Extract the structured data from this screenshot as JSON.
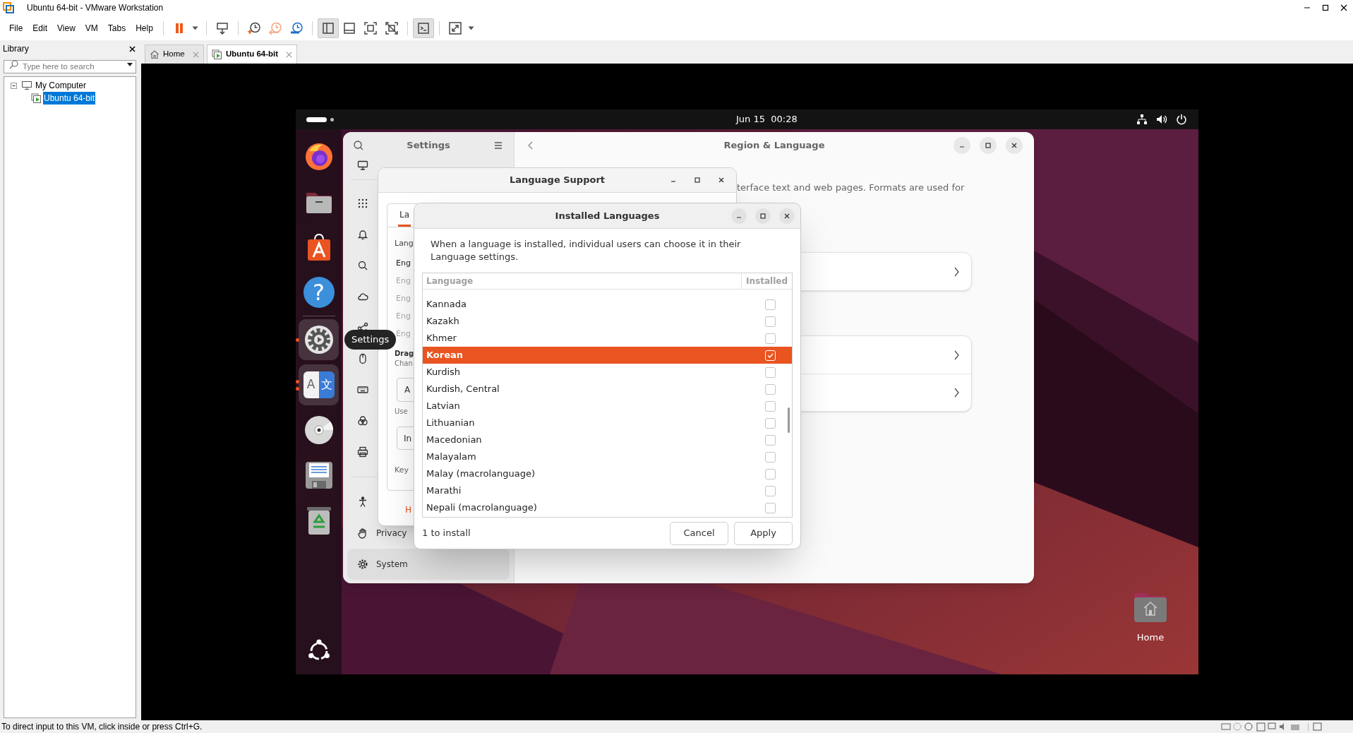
{
  "window": {
    "title": "Ubuntu 64-bit - VMware Workstation"
  },
  "menu": [
    {
      "label": "File"
    },
    {
      "label": "Edit"
    },
    {
      "label": "View"
    },
    {
      "label": "VM"
    },
    {
      "label": "Tabs"
    },
    {
      "label": "Help"
    }
  ],
  "toolbar_groups": [
    {
      "items": [
        {
          "kind": "pause",
          "selected": false
        },
        {
          "kind": "caret",
          "selected": false
        }
      ]
    },
    {
      "items": [
        {
          "kind": "send_keys",
          "selected": false
        }
      ]
    },
    {
      "items": [
        {
          "kind": "snapshot",
          "selected": false
        },
        {
          "kind": "revert",
          "selected": false
        },
        {
          "kind": "snapshot_manager",
          "selected": false
        }
      ]
    },
    {
      "items": [
        {
          "kind": "library_view",
          "selected": true
        },
        {
          "kind": "thumbnail_bar",
          "selected": false
        },
        {
          "kind": "full_screen",
          "selected": false
        },
        {
          "kind": "unity",
          "selected": false
        }
      ]
    },
    {
      "items": [
        {
          "kind": "console_view",
          "selected": true
        }
      ]
    },
    {
      "items": [
        {
          "kind": "stretch",
          "selected": false
        },
        {
          "kind": "caret",
          "selected": false
        }
      ]
    }
  ],
  "library": {
    "title": "Library",
    "search": {
      "placeholder": "Type here to search"
    },
    "tree": [
      {
        "label": "My Computer",
        "expanded": true,
        "selected": false,
        "children": [
          {
            "label": "Ubuntu 64-bit",
            "selected": true
          }
        ]
      }
    ]
  },
  "tabs": [
    {
      "label": "Home",
      "kind": "home",
      "selected": false
    },
    {
      "label": "Ubuntu 64-bit",
      "kind": "vm",
      "selected": true
    }
  ],
  "guest": {
    "top_bar": {
      "clock": "Jun 15  00:28"
    },
    "dock_groups": [
      {
        "items": [
          {
            "kind": "browser",
            "running": false
          },
          {
            "kind": "files",
            "running": false
          },
          {
            "kind": "app_center",
            "running": false
          },
          {
            "kind": "help",
            "glyph": "?",
            "running": false
          }
        ]
      },
      {
        "items": [
          {
            "kind": "settings",
            "running": true,
            "multiple_windows": false
          },
          {
            "kind": "language",
            "glyphs": [
              "A",
              "文"
            ],
            "running": true,
            "multiple_windows": true
          },
          {
            "kind": "disc",
            "running": false
          },
          {
            "kind": "floppy",
            "running": false
          },
          {
            "kind": "trash",
            "running": false
          }
        ]
      }
    ],
    "dock_tooltip": "Settings",
    "settings": {
      "title": "Settings",
      "page_title": "Region & Language",
      "intro": "terface text and web pages. Formats are used for",
      "sidebar_groups": [
        {
          "items": [
            {
              "kind": "display",
              "selected": false
            }
          ]
        },
        {
          "items": [
            {
              "kind": "apps",
              "selected": false
            },
            {
              "kind": "notifications",
              "selected": false
            },
            {
              "kind": "search",
              "selected": false
            },
            {
              "kind": "cloud",
              "selected": false
            },
            {
              "kind": "sharing",
              "selected": false
            },
            {
              "kind": "mouse",
              "selected": false
            },
            {
              "kind": "keyboard",
              "selected": false
            },
            {
              "kind": "color",
              "selected": false
            },
            {
              "kind": "printer",
              "selected": false
            }
          ]
        },
        {
          "items": [
            {
              "kind": "accessibility",
              "selected": false
            },
            {
              "kind": "privacy",
              "label": "Privacy",
              "selected": false
            },
            {
              "kind": "system",
              "label": "System",
              "selected": true
            }
          ]
        }
      ],
      "cards": [
        {
          "rows": [
            {
              "kind": "link"
            }
          ]
        },
        {
          "rows": [
            {
              "kind": "link"
            },
            {
              "kind": "link"
            }
          ]
        }
      ]
    },
    "language_support": {
      "title": "Language Support",
      "tab": "La",
      "heading": "Lang",
      "languages": [
        {
          "label": "Eng",
          "selected": true
        },
        {
          "label": "Eng",
          "selected": false
        },
        {
          "label": "Eng",
          "selected": false
        },
        {
          "label": "Eng",
          "selected": false
        },
        {
          "label": "Eng",
          "selected": false
        }
      ],
      "drag_title": "Drag",
      "drag_hint": "Chan",
      "first_button": "A",
      "use_label": "Use",
      "second_button": "In",
      "keyboard_label": "Key",
      "help_link": "H"
    },
    "installed_languages": {
      "title": "Installed Languages",
      "description": "When a language is installed, individual users can choose it in their Language settings.",
      "columns": [
        "Language",
        "Installed"
      ],
      "rows": [
        {
          "language": "Kannada",
          "installed": false,
          "selected": false
        },
        {
          "language": "Kazakh",
          "installed": false,
          "selected": false
        },
        {
          "language": "Khmer",
          "installed": false,
          "selected": false
        },
        {
          "language": "Korean",
          "installed": true,
          "selected": true
        },
        {
          "language": "Kurdish",
          "installed": false,
          "selected": false
        },
        {
          "language": "Kurdish, Central",
          "installed": false,
          "selected": false
        },
        {
          "language": "Latvian",
          "installed": false,
          "selected": false
        },
        {
          "language": "Lithuanian",
          "installed": false,
          "selected": false
        },
        {
          "language": "Macedonian",
          "installed": false,
          "selected": false
        },
        {
          "language": "Malayalam",
          "installed": false,
          "selected": false
        },
        {
          "language": "Malay (macrolanguage)",
          "installed": false,
          "selected": false
        },
        {
          "language": "Marathi",
          "installed": false,
          "selected": false
        },
        {
          "language": "Nepali (macrolanguage)",
          "installed": false,
          "selected": false
        }
      ],
      "summary": "1 to install",
      "buttons": [
        {
          "label": "Cancel"
        },
        {
          "label": "Apply"
        }
      ]
    },
    "desktop_icons": [
      {
        "label": "Home",
        "kind": "home_folder"
      }
    ]
  },
  "status_bar": {
    "message": "To direct input to this VM, click inside or press Ctrl+G."
  }
}
